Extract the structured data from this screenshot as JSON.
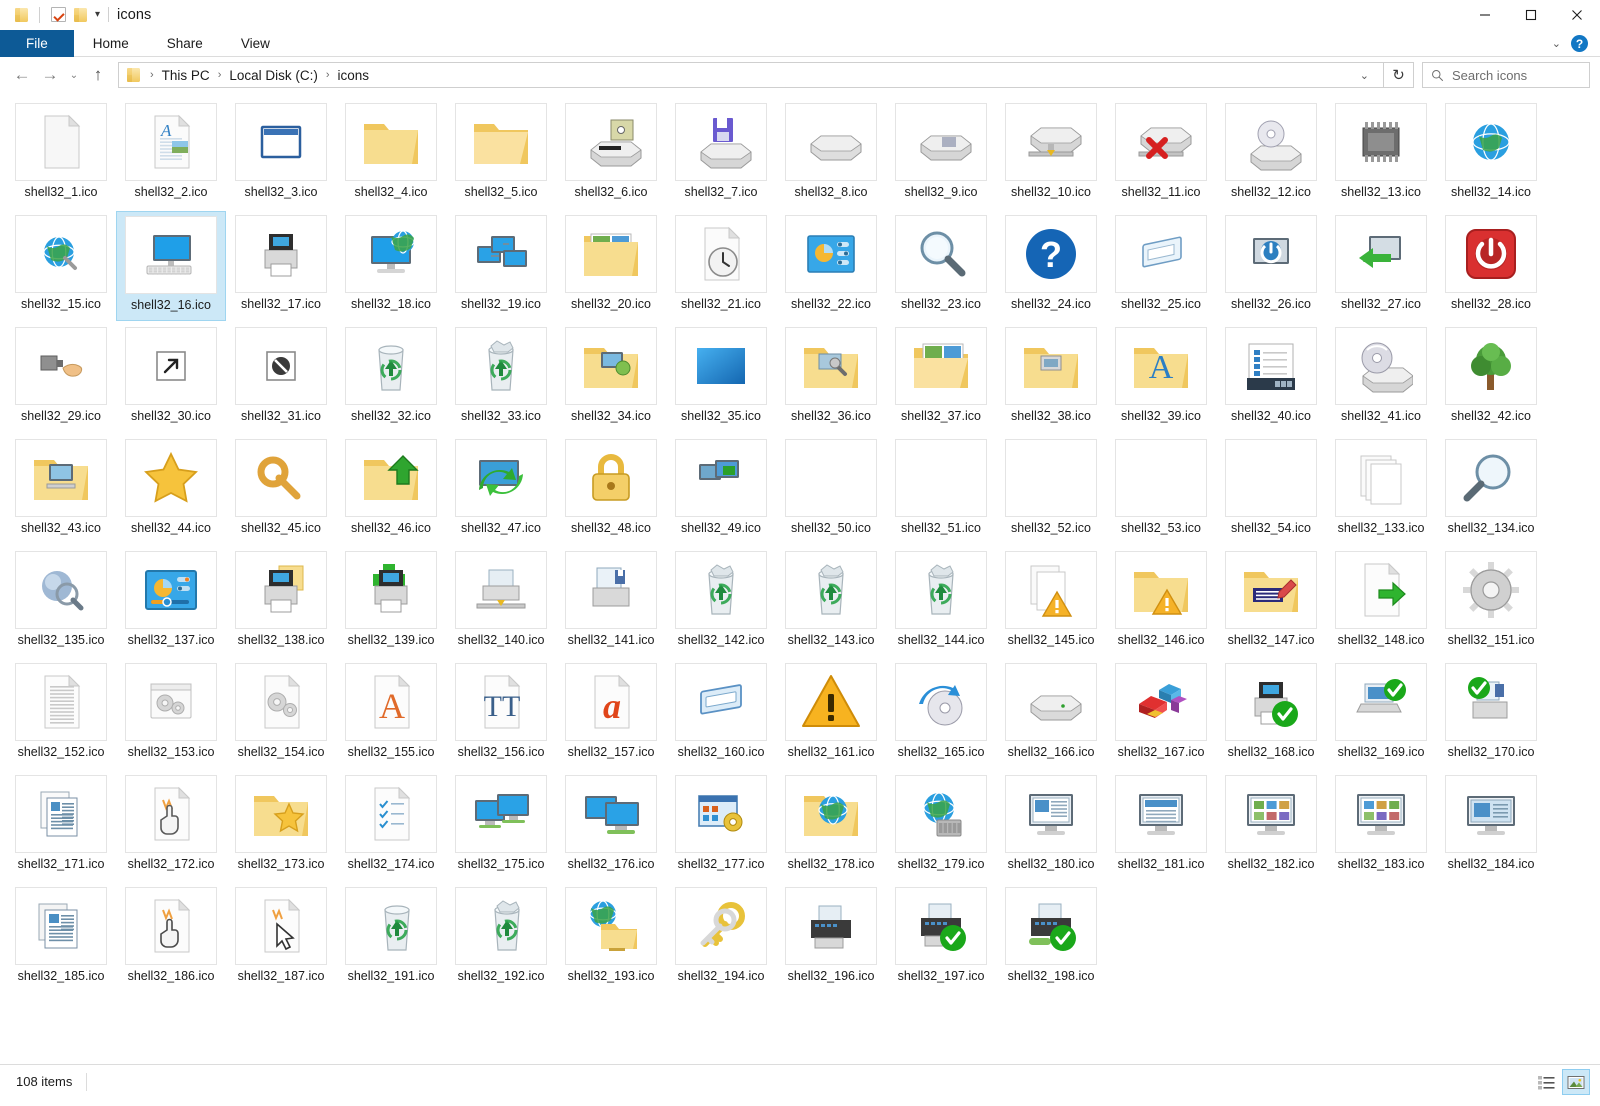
{
  "window": {
    "title": "icons",
    "quick_access": [
      "folder-icon",
      "checkbox-icon",
      "folder-icon",
      "dropdown-caret"
    ],
    "controls": {
      "minimize": "minimize-icon",
      "maximize": "maximize-icon",
      "close": "close-icon"
    }
  },
  "ribbon": {
    "tabs": [
      {
        "label": "File",
        "selected": true
      },
      {
        "label": "Home",
        "selected": false
      },
      {
        "label": "Share",
        "selected": false
      },
      {
        "label": "View",
        "selected": false
      }
    ],
    "collapse_caret": "⌄",
    "help_label": "?"
  },
  "addressbar": {
    "back": "←",
    "forward": "→",
    "recent": "⌄",
    "up": "↑",
    "breadcrumbs": [
      "This PC",
      "Local Disk (C:)",
      "icons"
    ],
    "crumb_separator": "›",
    "history_caret": "⌄",
    "refresh": "↻",
    "search_icon": "search-icon",
    "search_placeholder": "Search icons"
  },
  "status": {
    "item_count": "108 items",
    "views": [
      {
        "name": "details-view-button",
        "selected": false
      },
      {
        "name": "large-icons-view-button",
        "selected": true
      }
    ]
  },
  "files": [
    {
      "name": "shell32_1.ico",
      "icon": "blank-document"
    },
    {
      "name": "shell32_2.ico",
      "icon": "wordpad-document"
    },
    {
      "name": "shell32_3.ico",
      "icon": "application-window"
    },
    {
      "name": "shell32_4.ico",
      "icon": "folder-closed"
    },
    {
      "name": "shell32_5.ico",
      "icon": "folder-open"
    },
    {
      "name": "shell32_6.ico",
      "icon": "floppy-drive-5"
    },
    {
      "name": "shell32_7.ico",
      "icon": "floppy-drive-3"
    },
    {
      "name": "shell32_8.ico",
      "icon": "removable-drive"
    },
    {
      "name": "shell32_9.ico",
      "icon": "hard-drive"
    },
    {
      "name": "shell32_10.ico",
      "icon": "network-drive"
    },
    {
      "name": "shell32_11.ico",
      "icon": "network-drive-disconnected"
    },
    {
      "name": "shell32_12.ico",
      "icon": "cd-drive"
    },
    {
      "name": "shell32_13.ico",
      "icon": "ram-chip"
    },
    {
      "name": "shell32_14.ico",
      "icon": "internet-globe"
    },
    {
      "name": "shell32_15.ico",
      "icon": "internet-globe-small"
    },
    {
      "name": "shell32_16.ico",
      "icon": "this-pc-monitor",
      "selected": true
    },
    {
      "name": "shell32_17.ico",
      "icon": "printer"
    },
    {
      "name": "shell32_18.ico",
      "icon": "network-globe-monitor"
    },
    {
      "name": "shell32_19.ico",
      "icon": "network-cascade"
    },
    {
      "name": "shell32_20.ico",
      "icon": "pictures-folder"
    },
    {
      "name": "shell32_21.ico",
      "icon": "recent-document-clock"
    },
    {
      "name": "shell32_22.ico",
      "icon": "control-panel-settings"
    },
    {
      "name": "shell32_23.ico",
      "icon": "magnifier-search"
    },
    {
      "name": "shell32_24.ico",
      "icon": "help-question"
    },
    {
      "name": "shell32_25.ico",
      "icon": "run-dialog"
    },
    {
      "name": "shell32_26.ico",
      "icon": "suspend-monitor"
    },
    {
      "name": "shell32_27.ico",
      "icon": "log-off-arrow"
    },
    {
      "name": "shell32_28.ico",
      "icon": "shut-down-power"
    },
    {
      "name": "shell32_29.ico",
      "icon": "share-hand"
    },
    {
      "name": "shell32_30.ico",
      "icon": "shortcut-arrow"
    },
    {
      "name": "shell32_31.ico",
      "icon": "no-access-denied"
    },
    {
      "name": "shell32_32.ico",
      "icon": "recycle-bin-empty"
    },
    {
      "name": "shell32_33.ico",
      "icon": "recycle-bin-full"
    },
    {
      "name": "shell32_34.ico",
      "icon": "dialup-networking-folder"
    },
    {
      "name": "shell32_35.ico",
      "icon": "desktop-blue"
    },
    {
      "name": "shell32_36.ico",
      "icon": "program-folder-tools"
    },
    {
      "name": "shell32_37.ico",
      "icon": "pictures-folder-open"
    },
    {
      "name": "shell32_38.ico",
      "icon": "documents-folder"
    },
    {
      "name": "shell32_39.ico",
      "icon": "fonts-folder"
    },
    {
      "name": "shell32_40.ico",
      "icon": "task-list-window"
    },
    {
      "name": "shell32_41.ico",
      "icon": "audio-cd"
    },
    {
      "name": "shell32_42.ico",
      "icon": "tree-network"
    },
    {
      "name": "shell32_43.ico",
      "icon": "computer-folder"
    },
    {
      "name": "shell32_44.ico",
      "icon": "favorites-star"
    },
    {
      "name": "shell32_45.ico",
      "icon": "key-permissions"
    },
    {
      "name": "shell32_46.ico",
      "icon": "folder-up-arrow"
    },
    {
      "name": "shell32_47.ico",
      "icon": "sync-monitor"
    },
    {
      "name": "shell32_48.ico",
      "icon": "padlock-secure"
    },
    {
      "name": "shell32_49.ico",
      "icon": "network-computers"
    },
    {
      "name": "shell32_50.ico",
      "icon": "blank"
    },
    {
      "name": "shell32_51.ico",
      "icon": "blank"
    },
    {
      "name": "shell32_52.ico",
      "icon": "blank"
    },
    {
      "name": "shell32_53.ico",
      "icon": "blank"
    },
    {
      "name": "shell32_54.ico",
      "icon": "blank"
    },
    {
      "name": "shell32_133.ico",
      "icon": "stacked-pages"
    },
    {
      "name": "shell32_134.ico",
      "icon": "search-magnifier-large"
    },
    {
      "name": "shell32_135.ico",
      "icon": "search-results-sphere"
    },
    {
      "name": "shell32_137.ico",
      "icon": "control-panel-dashboard"
    },
    {
      "name": "shell32_138.ico",
      "icon": "printer-folder"
    },
    {
      "name": "shell32_139.ico",
      "icon": "printer-add-green-plus"
    },
    {
      "name": "shell32_140.ico",
      "icon": "printer-network"
    },
    {
      "name": "shell32_141.ico",
      "icon": "printer-save"
    },
    {
      "name": "shell32_142.ico",
      "icon": "recycle-bin-variant-1"
    },
    {
      "name": "shell32_143.ico",
      "icon": "recycle-bin-variant-2"
    },
    {
      "name": "shell32_144.ico",
      "icon": "recycle-bin-variant-3"
    },
    {
      "name": "shell32_145.ico",
      "icon": "documents-warning"
    },
    {
      "name": "shell32_146.ico",
      "icon": "folder-warning"
    },
    {
      "name": "shell32_147.ico",
      "icon": "folder-script-edit"
    },
    {
      "name": "shell32_148.ico",
      "icon": "page-green-arrow"
    },
    {
      "name": "shell32_151.ico",
      "icon": "gear-settings"
    },
    {
      "name": "shell32_152.ico",
      "icon": "text-document-lines"
    },
    {
      "name": "shell32_153.ico",
      "icon": "dll-gears-window"
    },
    {
      "name": "shell32_154.ico",
      "icon": "dll-gears-page"
    },
    {
      "name": "shell32_155.ico",
      "icon": "font-file-a"
    },
    {
      "name": "shell32_156.ico",
      "icon": "truetype-font-tt"
    },
    {
      "name": "shell32_157.ico",
      "icon": "opentype-font-a"
    },
    {
      "name": "shell32_160.ico",
      "icon": "pointer-window-blue"
    },
    {
      "name": "shell32_161.ico",
      "icon": "warning-triangle"
    },
    {
      "name": "shell32_165.ico",
      "icon": "burn-disc-arrow"
    },
    {
      "name": "shell32_166.ico",
      "icon": "hard-drive-plain"
    },
    {
      "name": "shell32_167.ico",
      "icon": "colored-blocks"
    },
    {
      "name": "shell32_168.ico",
      "icon": "printer-default-check"
    },
    {
      "name": "shell32_169.ico",
      "icon": "printer-laptop-check"
    },
    {
      "name": "shell32_170.ico",
      "icon": "printer-shared-check"
    },
    {
      "name": "shell32_171.ico",
      "icon": "document-properties"
    },
    {
      "name": "shell32_172.ico",
      "icon": "page-hand-click"
    },
    {
      "name": "shell32_173.ico",
      "icon": "folder-star-favorite"
    },
    {
      "name": "shell32_174.ico",
      "icon": "checklist-document"
    },
    {
      "name": "shell32_175.ico",
      "icon": "multiple-monitors"
    },
    {
      "name": "shell32_176.ico",
      "icon": "dual-monitors"
    },
    {
      "name": "shell32_177.ico",
      "icon": "program-settings-window"
    },
    {
      "name": "shell32_178.ico",
      "icon": "globe-folder"
    },
    {
      "name": "shell32_179.ico",
      "icon": "globe-network-gear"
    },
    {
      "name": "shell32_180.ico",
      "icon": "monitor-content-1"
    },
    {
      "name": "shell32_181.ico",
      "icon": "monitor-content-2"
    },
    {
      "name": "shell32_182.ico",
      "icon": "monitor-grid-1"
    },
    {
      "name": "shell32_183.ico",
      "icon": "monitor-grid-2"
    },
    {
      "name": "shell32_184.ico",
      "icon": "monitor-panel"
    },
    {
      "name": "shell32_185.ico",
      "icon": "window-list-view"
    },
    {
      "name": "shell32_186.ico",
      "icon": "page-hand-pointer"
    },
    {
      "name": "shell32_187.ico",
      "icon": "page-arrow-pointer"
    },
    {
      "name": "shell32_191.ico",
      "icon": "recycle-bin-side-1"
    },
    {
      "name": "shell32_192.ico",
      "icon": "recycle-bin-side-2"
    },
    {
      "name": "shell32_193.ico",
      "icon": "globe-folder-network"
    },
    {
      "name": "shell32_194.ico",
      "icon": "keys-security"
    },
    {
      "name": "shell32_196.ico",
      "icon": "fax-machine"
    },
    {
      "name": "shell32_197.ico",
      "icon": "fax-default-check"
    },
    {
      "name": "shell32_198.ico",
      "icon": "fax-shared-check"
    }
  ],
  "colors": {
    "accent": "#0d5a96",
    "selection": "#cce8f7",
    "folder_yellow": "#f3ce6d",
    "green_check": "#1aa81a",
    "warning_orange": "#f7b320"
  }
}
